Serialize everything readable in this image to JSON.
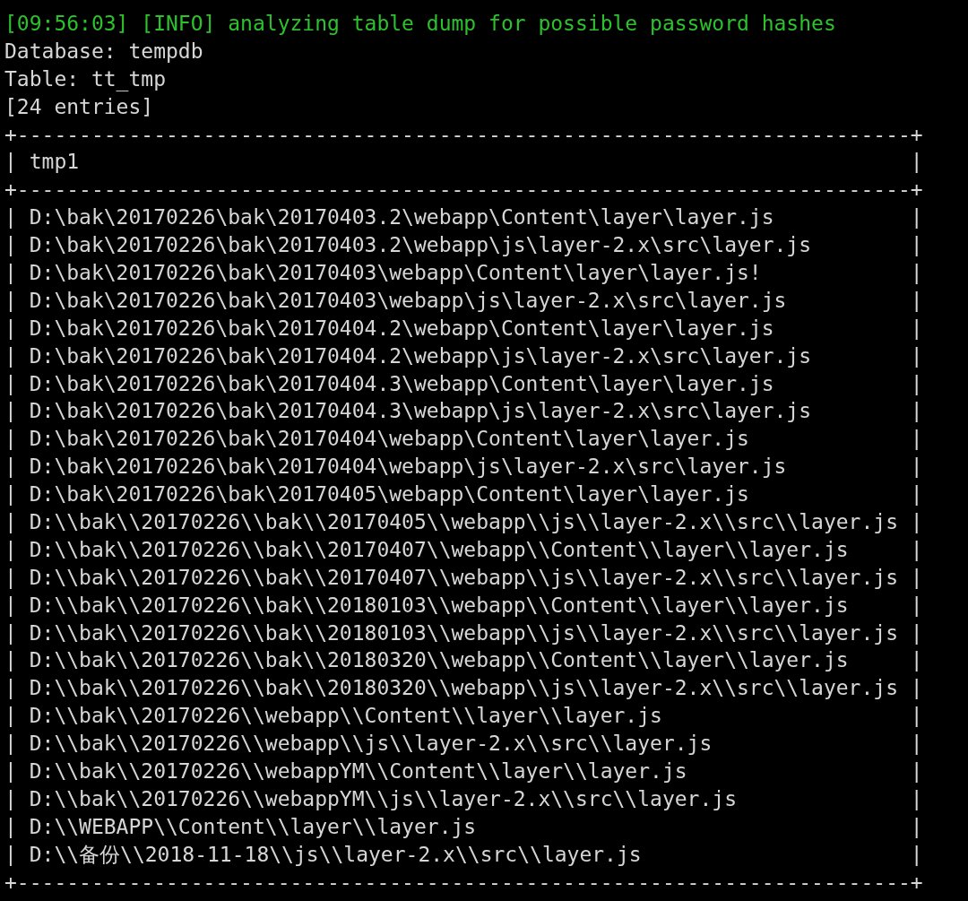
{
  "terminal": {
    "lines": [
      {
        "kind": "info",
        "text": "[09:56:03] [INFO] analyzing table dump for possible password hashes"
      },
      {
        "kind": "plain",
        "text": "Database: tempdb"
      },
      {
        "kind": "plain",
        "text": "Table: tt_tmp"
      },
      {
        "kind": "plain",
        "text": "[24 entries]"
      },
      {
        "kind": "border",
        "text": "+------------------------------------------------------------------------+"
      },
      {
        "kind": "row",
        "text": "| tmp1",
        "end": "|"
      },
      {
        "kind": "border",
        "text": "+------------------------------------------------------------------------+"
      },
      {
        "kind": "row",
        "text": "| D:\\bak\\20170226\\bak\\20170403.2\\webapp\\Content\\layer\\layer.js",
        "end": "|"
      },
      {
        "kind": "row",
        "text": "| D:\\bak\\20170226\\bak\\20170403.2\\webapp\\js\\layer-2.x\\src\\layer.js",
        "end": "|"
      },
      {
        "kind": "row",
        "text": "| D:\\bak\\20170226\\bak\\20170403\\webapp\\Content\\layer\\layer.js!",
        "end": "|"
      },
      {
        "kind": "row",
        "text": "| D:\\bak\\20170226\\bak\\20170403\\webapp\\js\\layer-2.x\\src\\layer.js",
        "end": "|"
      },
      {
        "kind": "row",
        "text": "| D:\\bak\\20170226\\bak\\20170404.2\\webapp\\Content\\layer\\layer.js",
        "end": "|"
      },
      {
        "kind": "row",
        "text": "| D:\\bak\\20170226\\bak\\20170404.2\\webapp\\js\\layer-2.x\\src\\layer.js",
        "end": "|"
      },
      {
        "kind": "row",
        "text": "| D:\\bak\\20170226\\bak\\20170404.3\\webapp\\Content\\layer\\layer.js",
        "end": "|"
      },
      {
        "kind": "row",
        "text": "| D:\\bak\\20170226\\bak\\20170404.3\\webapp\\js\\layer-2.x\\src\\layer.js",
        "end": "|"
      },
      {
        "kind": "row",
        "text": "| D:\\bak\\20170226\\bak\\20170404\\webapp\\Content\\layer\\layer.js",
        "end": "|"
      },
      {
        "kind": "row",
        "text": "| D:\\bak\\20170226\\bak\\20170404\\webapp\\js\\layer-2.x\\src\\layer.js",
        "end": "|"
      },
      {
        "kind": "row",
        "text": "| D:\\bak\\20170226\\bak\\20170405\\webapp\\Content\\layer\\layer.js",
        "end": "|"
      },
      {
        "kind": "row",
        "text": "| D:\\\\bak\\\\20170226\\\\bak\\\\20170405\\\\webapp\\\\js\\\\layer-2.x\\\\src\\\\layer.js",
        "end": "|"
      },
      {
        "kind": "row",
        "text": "| D:\\\\bak\\\\20170226\\\\bak\\\\20170407\\\\webapp\\\\Content\\\\layer\\\\layer.js",
        "end": "|"
      },
      {
        "kind": "row",
        "text": "| D:\\\\bak\\\\20170226\\\\bak\\\\20170407\\\\webapp\\\\js\\\\layer-2.x\\\\src\\\\layer.js",
        "end": "|"
      },
      {
        "kind": "row",
        "text": "| D:\\\\bak\\\\20170226\\\\bak\\\\20180103\\\\webapp\\\\Content\\\\layer\\\\layer.js",
        "end": "|"
      },
      {
        "kind": "row",
        "text": "| D:\\\\bak\\\\20170226\\\\bak\\\\20180103\\\\webapp\\\\js\\\\layer-2.x\\\\src\\\\layer.js",
        "end": "|"
      },
      {
        "kind": "row",
        "text": "| D:\\\\bak\\\\20170226\\\\bak\\\\20180320\\\\webapp\\\\Content\\\\layer\\\\layer.js",
        "end": "|"
      },
      {
        "kind": "row",
        "text": "| D:\\\\bak\\\\20170226\\\\bak\\\\20180320\\\\webapp\\\\js\\\\layer-2.x\\\\src\\\\layer.js",
        "end": "|"
      },
      {
        "kind": "row",
        "text": "| D:\\\\bak\\\\20170226\\\\webapp\\\\Content\\\\layer\\\\layer.js",
        "end": "|"
      },
      {
        "kind": "row",
        "text": "| D:\\\\bak\\\\20170226\\\\webapp\\\\js\\\\layer-2.x\\\\src\\\\layer.js",
        "end": "|"
      },
      {
        "kind": "row",
        "text": "| D:\\\\bak\\\\20170226\\\\webappYM\\\\Content\\\\layer\\\\layer.js",
        "end": "|"
      },
      {
        "kind": "row",
        "text": "| D:\\\\bak\\\\20170226\\\\webappYM\\\\js\\\\layer-2.x\\\\src\\\\layer.js",
        "end": "|"
      },
      {
        "kind": "row",
        "text": "| D:\\\\WEBAPP\\\\Content\\\\layer\\\\layer.js",
        "end": "|"
      },
      {
        "kind": "row",
        "text": "| D:\\\\备份\\\\2018-11-18\\\\js\\\\layer-2.x\\\\src\\\\layer.js",
        "end": "|"
      },
      {
        "kind": "border",
        "text": "+------------------------------------------------------------------------+"
      }
    ]
  }
}
